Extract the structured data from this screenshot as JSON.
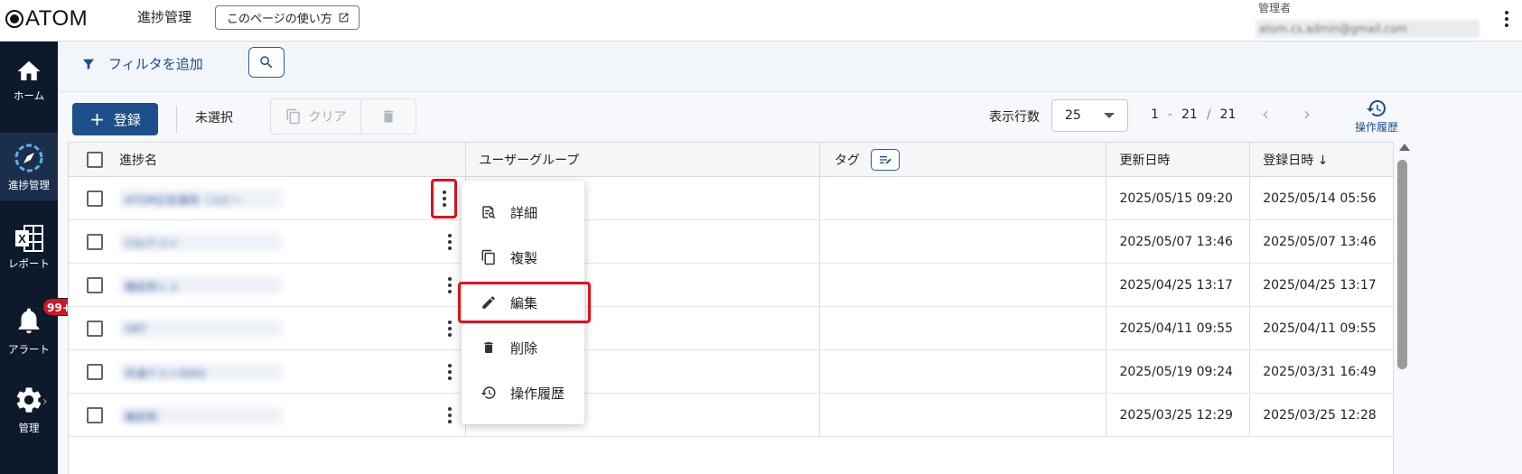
{
  "header": {
    "logo": "ATOM",
    "page_title": "進捗管理",
    "help_label": "このページの使い方",
    "user_role": "管理者",
    "user_email": "atom.cs.admin@gmail.com"
  },
  "sidebar": {
    "items": [
      {
        "label": "ホーム",
        "icon": "home-icon"
      },
      {
        "label": "進捗管理",
        "icon": "progress-compass-icon",
        "active": true
      },
      {
        "label": "レポート",
        "icon": "excel-report-icon"
      },
      {
        "label": "アラート",
        "icon": "bell-icon",
        "badge": "99+"
      },
      {
        "label": "管理",
        "icon": "gear-icon"
      }
    ]
  },
  "filterbar": {
    "add_filter_label": "フィルタを追加"
  },
  "toolbar": {
    "register_label": "登録",
    "selection_status": "未選択",
    "clear_label": "クリア",
    "rows_label": "表示行数",
    "rows_value": "25",
    "page_from": "1",
    "page_to": "21",
    "page_total": "21",
    "history_label": "操作履歴"
  },
  "table": {
    "columns": [
      "進捗名",
      "ユーザーグループ",
      "タグ",
      "更新日時",
      "登録日時 ↓"
    ],
    "rows": [
      {
        "name": "ATOM広告運用（コピー",
        "updated": "2025/05/15 09:20",
        "created": "2025/05/14 05:56"
      },
      {
        "name": "CSVテスト",
        "updated": "2025/05/07 13:46",
        "created": "2025/05/07 13:46"
      },
      {
        "name": "確認用１２",
        "updated": "2025/04/25 13:17",
        "created": "2025/04/25 13:17"
      },
      {
        "name": "GKY",
        "updated": "2025/04/11 09:55",
        "created": "2025/04/11 09:55"
      },
      {
        "name": "共通テスト0001",
        "updated": "2025/05/19 09:24",
        "created": "2025/03/31 16:49"
      },
      {
        "name": "確認用",
        "updated": "2025/03/25 12:29",
        "created": "2025/03/25 12:28"
      }
    ]
  },
  "context_menu": {
    "items": [
      {
        "label": "詳細",
        "icon": "detail-search-icon"
      },
      {
        "label": "複製",
        "icon": "copy-icon"
      },
      {
        "label": "編集",
        "icon": "pencil-icon"
      },
      {
        "label": "削除",
        "icon": "trash-icon"
      },
      {
        "label": "操作履歴",
        "icon": "history-icon"
      }
    ]
  },
  "colors": {
    "accent": "#1d4f8a",
    "sidebar_bg": "#0e1a2b",
    "highlight": "#e0101b",
    "badge": "#d0162a"
  }
}
